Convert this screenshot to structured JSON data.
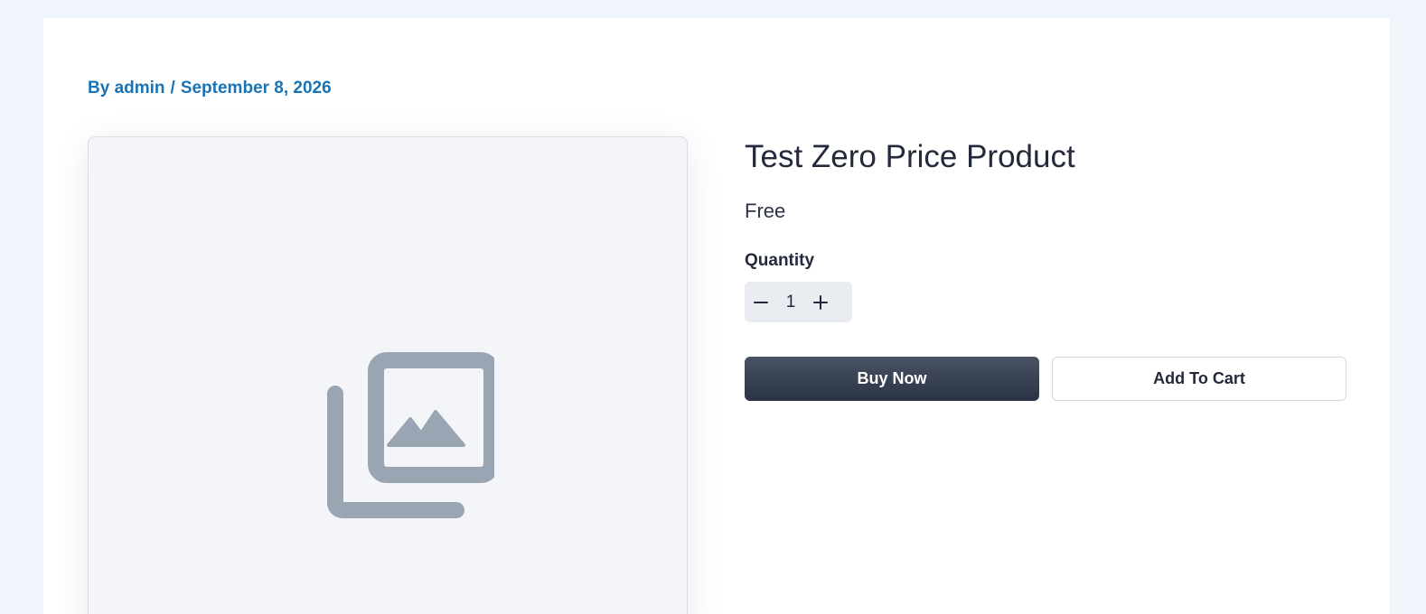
{
  "post_meta": {
    "author_prefix": "By admin",
    "separator": "/",
    "date": "September 8, 2026"
  },
  "product": {
    "image_icon": "image-gallery-placeholder-icon",
    "title": "Test Zero Price Product",
    "price": "Free",
    "quantity_label": "Quantity",
    "quantity_value": "1",
    "minus_icon": "minus-icon",
    "plus_icon": "plus-icon",
    "buy_now_label": "Buy Now",
    "add_to_cart_label": "Add To Cart"
  },
  "colors": {
    "page_background": "#f0f5fc",
    "meta_link": "#1a73b5",
    "placeholder_icon": "#9aa5b4",
    "buy_button": "#2f3949"
  }
}
